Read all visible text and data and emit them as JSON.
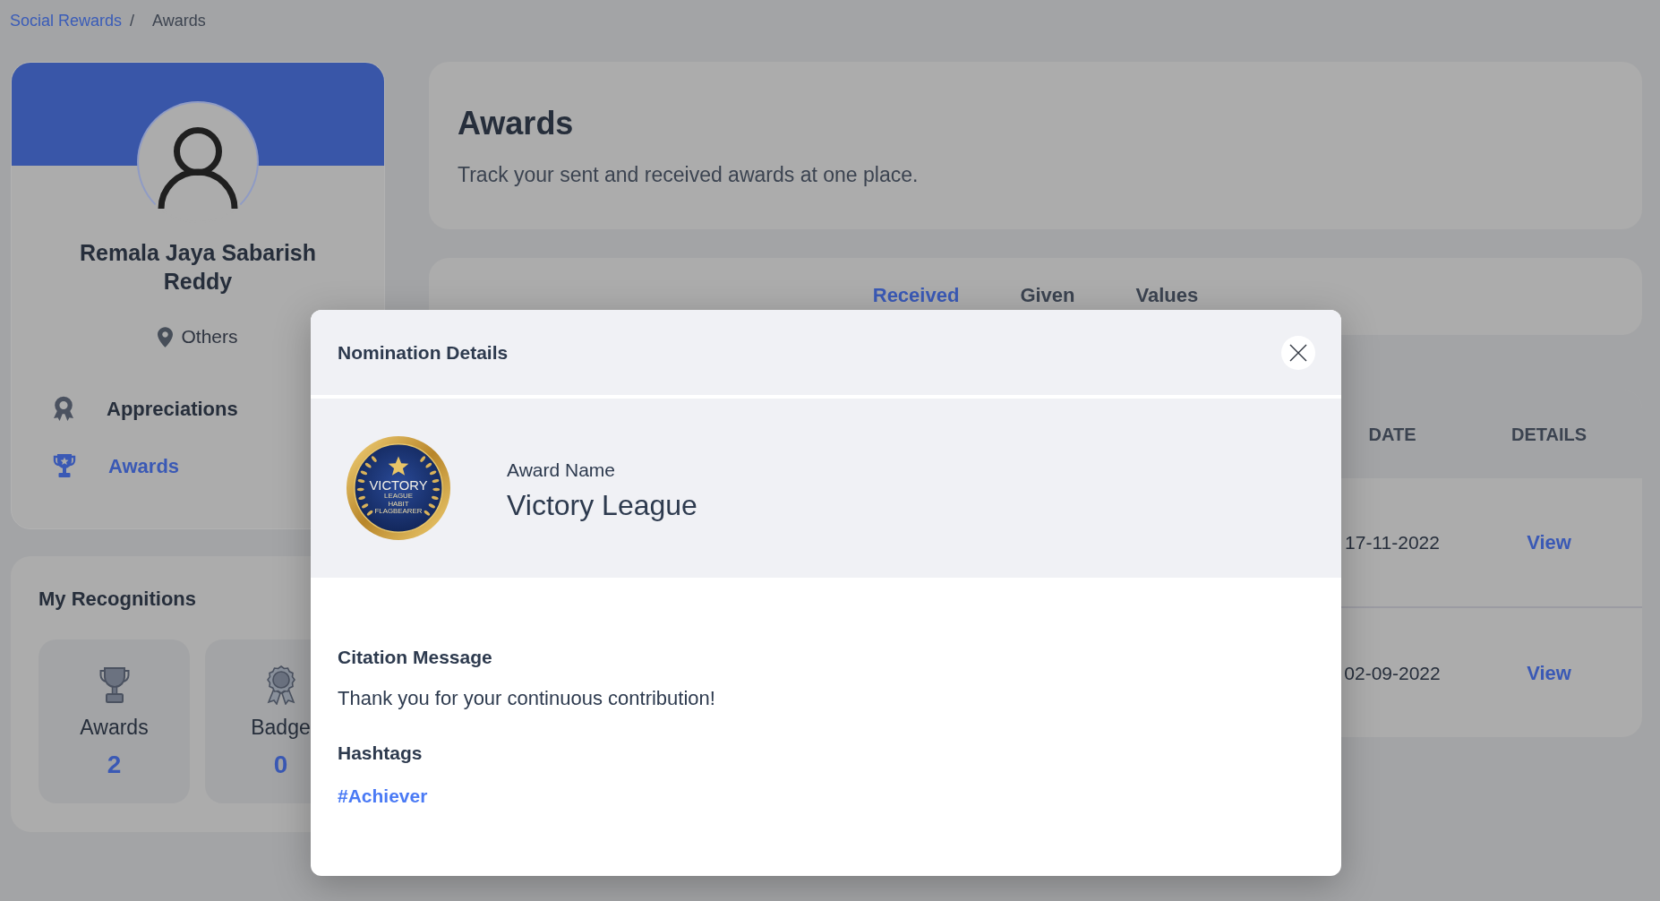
{
  "breadcrumb": {
    "items": [
      {
        "label": "Social Rewards",
        "kind": "link"
      },
      {
        "label": "Awards",
        "kind": "current"
      }
    ],
    "separator": "/"
  },
  "profile": {
    "name": "Remala Jaya Sabarish Reddy",
    "location": "Others",
    "menu": [
      {
        "label": "Appreciations",
        "selected": false
      },
      {
        "label": "Awards",
        "selected": true
      }
    ]
  },
  "recognitions": {
    "title": "My Recognitions",
    "tiles": [
      {
        "label": "Awards",
        "count": "2"
      },
      {
        "label": "Badge",
        "count": "0"
      }
    ]
  },
  "header": {
    "title": "Awards",
    "subtitle": "Track your sent and received awards at one place."
  },
  "tabs": [
    {
      "label": "Received",
      "selected": true
    },
    {
      "label": "Given",
      "selected": false
    },
    {
      "label": "Values",
      "selected": false
    }
  ],
  "table": {
    "columns": [
      "DATE",
      "DETAILS"
    ],
    "rows": [
      {
        "date": "17-11-2022",
        "details": "View"
      },
      {
        "date": "02-09-2022",
        "details": "View"
      }
    ]
  },
  "dialog": {
    "title": "Nomination Details",
    "award": {
      "label": "Award Name",
      "name": "Victory League",
      "emblem_text": [
        "VICTORY",
        "LEAGUE",
        "HABIT",
        "FLAGBEARER"
      ]
    },
    "sections": [
      {
        "kind": "text",
        "heading": "Citation Message",
        "text": "Thank you for your continuous contribution!"
      },
      {
        "kind": "tags",
        "heading": "Hashtags",
        "tags": [
          "#Achiever"
        ]
      }
    ]
  }
}
